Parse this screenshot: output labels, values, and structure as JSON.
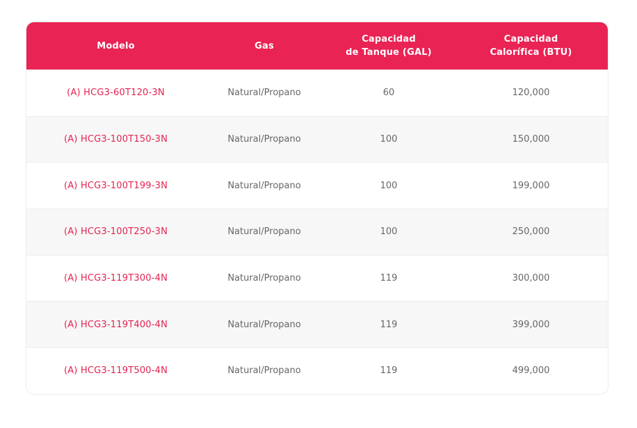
{
  "table": {
    "headers": [
      "Modelo",
      "Gas",
      "Capacidad\nde Tanque (GAL)",
      "Capacidad\nCalorífica (BTU)"
    ],
    "rows": [
      {
        "modelo": "(A) HCG3-60T120-3N",
        "gas": "Natural/Propano",
        "tanque": "60",
        "btu": "120,000"
      },
      {
        "modelo": "(A) HCG3-100T150-3N",
        "gas": "Natural/Propano",
        "tanque": "100",
        "btu": "150,000"
      },
      {
        "modelo": "(A) HCG3-100T199-3N",
        "gas": "Natural/Propano",
        "tanque": "100",
        "btu": "199,000"
      },
      {
        "modelo": "(A) HCG3-100T250-3N",
        "gas": "Natural/Propano",
        "tanque": "100",
        "btu": "250,000"
      },
      {
        "modelo": "(A) HCG3-119T300-4N",
        "gas": "Natural/Propano",
        "tanque": "119",
        "btu": "300,000"
      },
      {
        "modelo": "(A) HCG3-119T400-4N",
        "gas": "Natural/Propano",
        "tanque": "119",
        "btu": "399,000"
      },
      {
        "modelo": "(A) HCG3-119T500-4N",
        "gas": "Natural/Propano",
        "tanque": "119",
        "btu": "499,000"
      }
    ]
  },
  "colors": {
    "header_bg": "#e92354",
    "model_text": "#e5224f",
    "body_text": "#666666",
    "stripe": "#f7f7f7"
  }
}
